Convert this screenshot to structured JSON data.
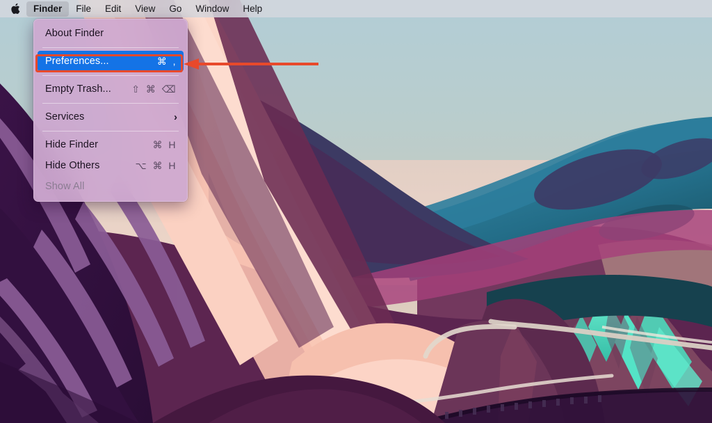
{
  "os": {
    "name": "macOS",
    "menubar": {
      "apple_icon": "apple-logo-icon",
      "items": [
        {
          "label": "Finder",
          "bold": true,
          "active": true
        },
        {
          "label": "File",
          "bold": false,
          "active": false
        },
        {
          "label": "Edit",
          "bold": false,
          "active": false
        },
        {
          "label": "View",
          "bold": false,
          "active": false
        },
        {
          "label": "Go",
          "bold": false,
          "active": false
        },
        {
          "label": "Window",
          "bold": false,
          "active": false
        },
        {
          "label": "Help",
          "bold": false,
          "active": false
        }
      ]
    },
    "finder_menu": {
      "title": "Finder",
      "items": [
        {
          "label": "About Finder",
          "shortcut": "",
          "selected": false,
          "disabled": false,
          "submenu": false
        },
        {
          "separator": true
        },
        {
          "label": "Preferences...",
          "shortcut": "⌘ ,",
          "selected": true,
          "disabled": false,
          "submenu": false
        },
        {
          "separator": true
        },
        {
          "label": "Empty Trash...",
          "shortcut": "⇧ ⌘ ⌫",
          "selected": false,
          "disabled": false,
          "submenu": false
        },
        {
          "separator": true
        },
        {
          "label": "Services",
          "shortcut": "",
          "selected": false,
          "disabled": false,
          "submenu": true,
          "submenu_glyph": "›"
        },
        {
          "separator": true
        },
        {
          "label": "Hide Finder",
          "shortcut": "⌘ H",
          "selected": false,
          "disabled": false,
          "submenu": false
        },
        {
          "label": "Hide Others",
          "shortcut": "⌥ ⌘ H",
          "selected": false,
          "disabled": false,
          "submenu": false
        },
        {
          "label": "Show All",
          "shortcut": "",
          "selected": false,
          "disabled": true,
          "submenu": false
        }
      ]
    }
  },
  "annotations": {
    "highlight_box": {
      "target": "Preferences...",
      "color": "#e8492b"
    },
    "arrow": {
      "color": "#e8492b",
      "direction": "left",
      "points_to": "Preferences..."
    }
  },
  "wallpaper": {
    "name": "macOS Big Sur Graphic",
    "colors": {
      "sky_top": "#b6ced6",
      "sky_mid": "#bfcfce",
      "sky_warm": "#e3cfc4",
      "sky_pink": "#f2d6c8",
      "teal_light": "#2f86a8",
      "teal_dark": "#1d5f78",
      "teal_deep": "#14414f",
      "navy": "#3c3a63",
      "mint": "#57e8c8",
      "mint_dark": "#3ec0a8",
      "salmon": "#f9c6b4",
      "salmon_light": "#fdd8ca",
      "rose": "#c9737f",
      "plum": "#6d2f58",
      "plum_dark": "#4a1f45",
      "purple_deep": "#32103f",
      "purple_mid": "#49205a",
      "purple_light": "#8a5c96",
      "magenta": "#a6407a",
      "road": "#d9cfc4"
    }
  }
}
